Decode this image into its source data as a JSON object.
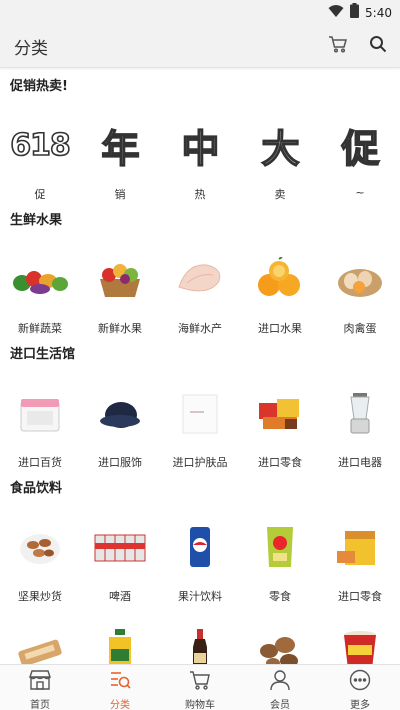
{
  "status": {
    "time": "5:40",
    "wifi_icon": "wifi-icon",
    "battery_icon": "battery-icon"
  },
  "header": {
    "title": "分类",
    "cart_icon": "cart-icon",
    "search_icon": "search-icon"
  },
  "sections": [
    {
      "title": "促销热卖!",
      "items": [
        {
          "label": "促",
          "glyph": "618"
        },
        {
          "label": "销",
          "glyph": "年"
        },
        {
          "label": "热",
          "glyph": "中"
        },
        {
          "label": "卖",
          "glyph": "大"
        },
        {
          "label": "~",
          "glyph": "促"
        }
      ]
    },
    {
      "title": "生鲜水果",
      "items": [
        {
          "label": "新鲜蔬菜",
          "icon": "vegetables-icon"
        },
        {
          "label": "新鲜水果",
          "icon": "fruit-basket-icon"
        },
        {
          "label": "海鲜水产",
          "icon": "fish-fillet-icon"
        },
        {
          "label": "进口水果",
          "icon": "oranges-icon"
        },
        {
          "label": "肉禽蛋",
          "icon": "eggs-icon"
        }
      ]
    },
    {
      "title": "进口生活馆",
      "items": [
        {
          "label": "进口百货",
          "icon": "storage-box-icon"
        },
        {
          "label": "进口服饰",
          "icon": "hat-icon"
        },
        {
          "label": "进口护肤品",
          "icon": "skincare-box-icon"
        },
        {
          "label": "进口零食",
          "icon": "snacks-icon"
        },
        {
          "label": "进口电器",
          "icon": "blender-icon"
        }
      ]
    },
    {
      "title": "食品饮料",
      "items": [
        {
          "label": "坚果炒货",
          "icon": "nuts-icon"
        },
        {
          "label": "啤酒",
          "icon": "beer-cans-icon"
        },
        {
          "label": "果汁饮料",
          "icon": "soda-can-icon"
        },
        {
          "label": "零食",
          "icon": "chips-bag-icon"
        },
        {
          "label": "进口零食",
          "icon": "snack-box-icon"
        },
        {
          "label": "",
          "icon": "biscuit-icon"
        },
        {
          "label": "",
          "icon": "oil-bottle-icon"
        },
        {
          "label": "",
          "icon": "soy-sauce-icon"
        },
        {
          "label": "",
          "icon": "mushrooms-icon"
        },
        {
          "label": "",
          "icon": "instant-noodle-icon"
        }
      ]
    }
  ],
  "tabs": [
    {
      "label": "首页",
      "icon": "home-store-icon",
      "active": false
    },
    {
      "label": "分类",
      "icon": "category-icon",
      "active": true
    },
    {
      "label": "购物车",
      "icon": "cart-icon",
      "active": false
    },
    {
      "label": "会员",
      "icon": "member-icon",
      "active": false
    },
    {
      "label": "更多",
      "icon": "more-icon",
      "active": false
    }
  ],
  "colors": {
    "accent": "#e8612c",
    "header_bg": "#f2f2f2"
  }
}
